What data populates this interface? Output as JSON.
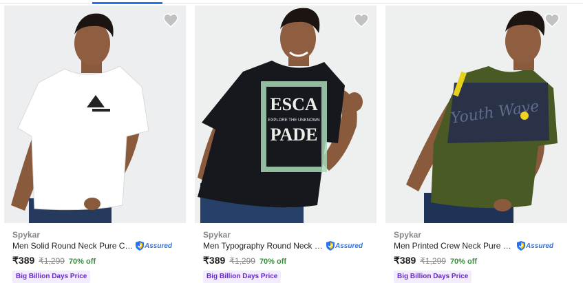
{
  "products": [
    {
      "brand": "Spykar",
      "title": "Men Solid Round Neck Pure Cott...",
      "assured_label": "Assured",
      "price": "₹389",
      "mrp": "₹1,299",
      "discount": "70% off",
      "badge": "Big Billion Days Price",
      "tshirt_color": "#ffffff",
      "icons": [
        "heart-icon",
        "assured-shield-icon"
      ]
    },
    {
      "brand": "Spykar",
      "title": "Men Typography Round Neck P...",
      "assured_label": "Assured",
      "price": "₹389",
      "mrp": "₹1,299",
      "discount": "70% off",
      "badge": "Big Billion Days Price",
      "print_text_1": "ESCA",
      "print_text_2": "EXPLORE THE UNKNOWN",
      "print_text_3": "PADE",
      "tshirt_color": "#16181d",
      "icons": [
        "heart-icon",
        "assured-shield-icon"
      ]
    },
    {
      "brand": "Spykar",
      "title": "Men Printed Crew Neck Pure Co...",
      "assured_label": "Assured",
      "price": "₹389",
      "mrp": "₹1,299",
      "discount": "70% off",
      "badge": "Big Billion Days Price",
      "print_text_1": "Youth Wave",
      "tshirt_color": "#4a5a24",
      "icons": [
        "heart-icon",
        "assured-shield-icon"
      ]
    }
  ],
  "colors": {
    "accent_blue": "#2874f0",
    "discount_green": "#388e3c",
    "badge_bg": "#f3ecff",
    "badge_text": "#6b24d6"
  }
}
